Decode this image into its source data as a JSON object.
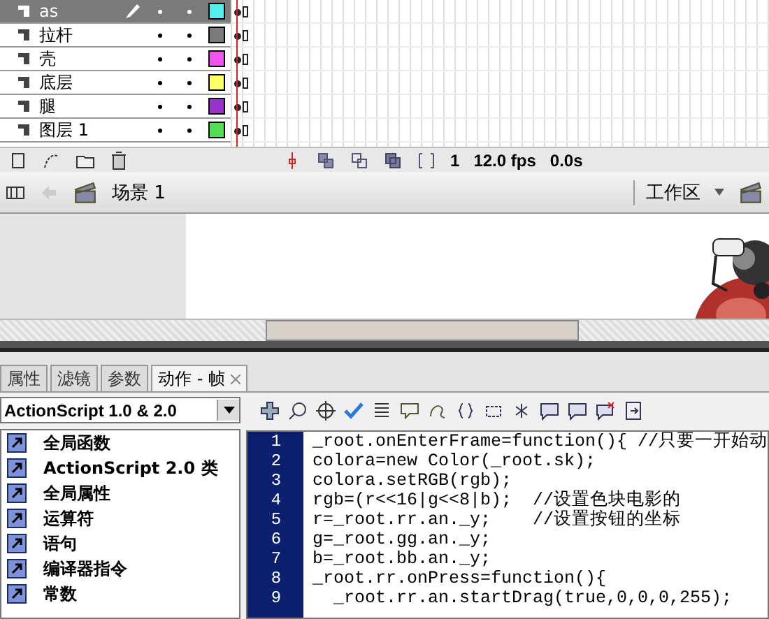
{
  "timeline": {
    "layers": [
      {
        "name": "as",
        "selected": true,
        "color": "#55eef0"
      },
      {
        "name": "拉杆",
        "selected": false,
        "color": "#7a7a7a"
      },
      {
        "name": "壳",
        "selected": false,
        "color": "#f055f0"
      },
      {
        "name": "底层",
        "selected": false,
        "color": "#ffff66"
      },
      {
        "name": "腿",
        "selected": false,
        "color": "#9933cc"
      },
      {
        "name": "图层 1",
        "selected": false,
        "color": "#55dd55"
      }
    ],
    "frame": "1",
    "fps": "12.0 fps",
    "time": "0.0s"
  },
  "scene_bar": {
    "scene": "场景 1",
    "workspace": "工作区"
  },
  "tabs": [
    {
      "label": "属性",
      "selected": false
    },
    {
      "label": "滤镜",
      "selected": false
    },
    {
      "label": "参数",
      "selected": false
    },
    {
      "label": "动作 - 帧",
      "selected": true
    }
  ],
  "actions": {
    "version": "ActionScript 1.0 & 2.0",
    "categories": [
      "全局函数",
      "ActionScript 2.0 类",
      "全局属性",
      "运算符",
      "语句",
      "编译器指令",
      "常数"
    ],
    "code": [
      {
        "number": "1",
        "text": "_root.onEnterFrame=function(){ //只要一开始动"
      },
      {
        "number": "2",
        "text": "colora=new Color(_root.sk);"
      },
      {
        "number": "3",
        "text": "colora.setRGB(rgb);"
      },
      {
        "number": "4",
        "text": "rgb=(r<<16|g<<8|b);  //设置色块电影的"
      },
      {
        "number": "5",
        "text": "r=_root.rr.an._y;    //设置按钮的坐标"
      },
      {
        "number": "6",
        "text": "g=_root.gg.an._y;"
      },
      {
        "number": "7",
        "text": "b=_root.bb.an._y;"
      },
      {
        "number": "8",
        "text": "_root.rr.onPress=function(){"
      },
      {
        "number": "9",
        "text": "  _root.rr.an.startDrag(true,0,0,0,255);"
      }
    ]
  }
}
